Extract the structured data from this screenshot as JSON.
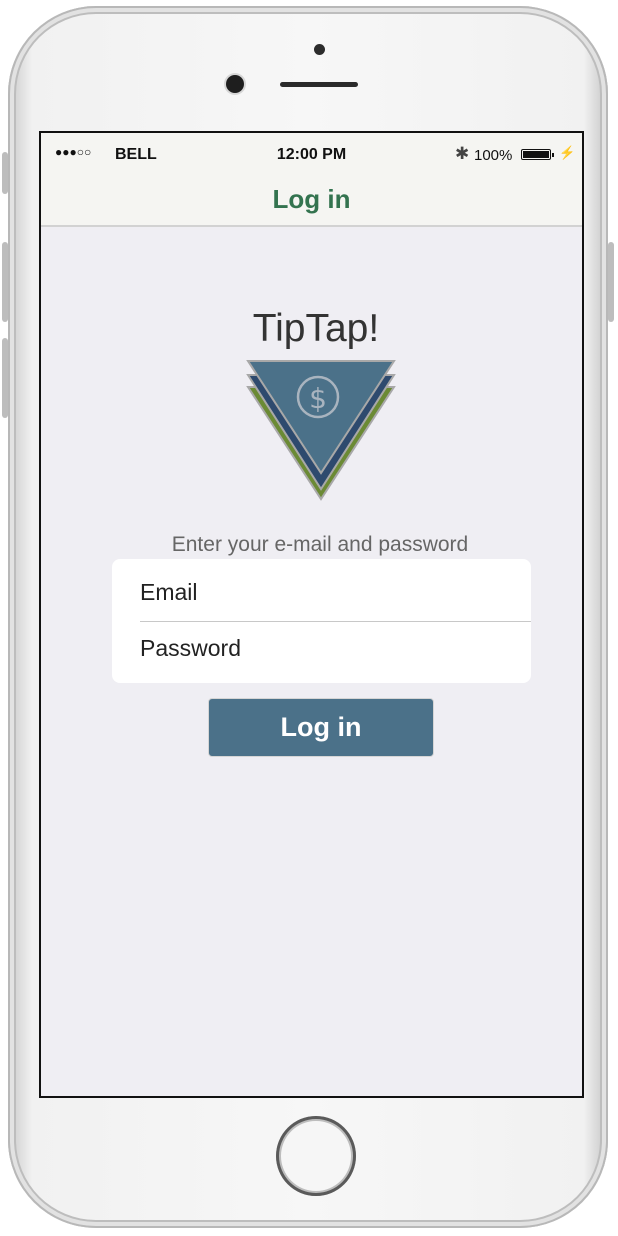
{
  "status_bar": {
    "signal": "●●●○○",
    "carrier": "BELL",
    "time": "12:00 PM",
    "bluetooth_icon": "bluetooth-icon",
    "battery_percent": "100%",
    "battery_icon": "battery-full-charging-icon"
  },
  "nav": {
    "title": "Log in"
  },
  "branding": {
    "app_name": "TipTap!",
    "logo_icon": "dollar-triangle-logo"
  },
  "form": {
    "subtitle": "Enter your e-mail and password",
    "email_placeholder": "Email",
    "password_placeholder": "Password",
    "submit_label": "Log in"
  },
  "colors": {
    "nav_title": "#33734f",
    "button_bg": "#4b7189",
    "logo_blue": "#4b7189",
    "logo_green": "#6b8a34",
    "screen_bg": "#efeef3"
  }
}
